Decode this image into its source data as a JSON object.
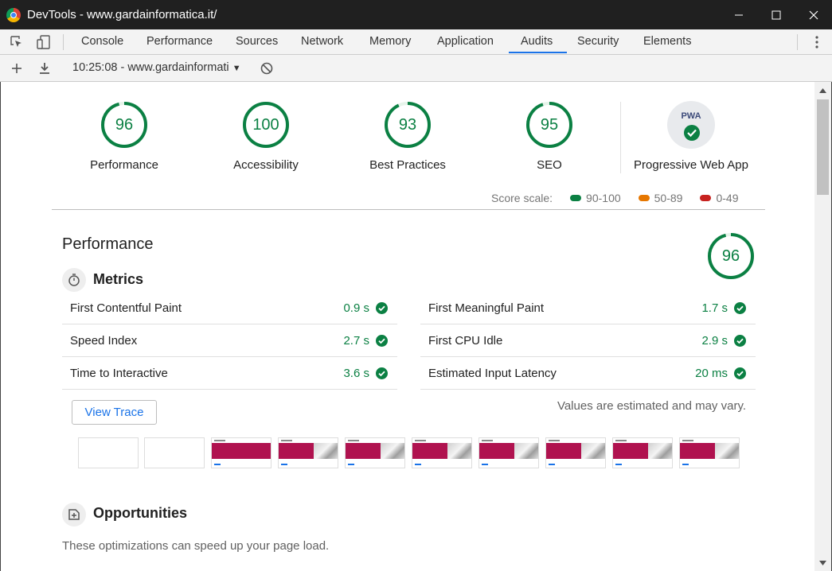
{
  "window": {
    "title": "DevTools - www.gardainformatica.it/"
  },
  "tabs": [
    {
      "label": "Console"
    },
    {
      "label": "Performance"
    },
    {
      "label": "Sources"
    },
    {
      "label": "Network"
    },
    {
      "label": "Memory"
    },
    {
      "label": "Application"
    },
    {
      "label": "Audits",
      "active": true
    },
    {
      "label": "Security"
    },
    {
      "label": "Elements"
    }
  ],
  "toolbar": {
    "report_selector": "10:25:08 - www.gardainformati"
  },
  "categories": [
    {
      "label": "Performance",
      "score": "96"
    },
    {
      "label": "Accessibility",
      "score": "100"
    },
    {
      "label": "Best Practices",
      "score": "93"
    },
    {
      "label": "SEO",
      "score": "95"
    },
    {
      "label": "Progressive Web App",
      "badge": "PWA"
    }
  ],
  "score_scale": {
    "label": "Score scale:",
    "ranges": [
      {
        "label": "90-100",
        "color": "#0b8043"
      },
      {
        "label": "50-89",
        "color": "#e67700"
      },
      {
        "label": "0-49",
        "color": "#c7221f"
      }
    ]
  },
  "performance": {
    "title": "Performance",
    "score": "96",
    "metrics_title": "Metrics",
    "metrics_left": [
      {
        "label": "First Contentful Paint",
        "value": "0.9 s"
      },
      {
        "label": "Speed Index",
        "value": "2.7 s"
      },
      {
        "label": "Time to Interactive",
        "value": "3.6 s"
      }
    ],
    "metrics_right": [
      {
        "label": "First Meaningful Paint",
        "value": "1.7 s"
      },
      {
        "label": "First CPU Idle",
        "value": "2.9 s"
      },
      {
        "label": "Estimated Input Latency",
        "value": "20 ms"
      }
    ],
    "view_trace": "View Trace",
    "estimate_note": "Values are estimated and may vary.",
    "opportunities_title": "Opportunities",
    "opportunities_desc": "These optimizations can speed up your page load."
  },
  "colors": {
    "pass": "#0b8043",
    "accent": "#1a73e8"
  }
}
